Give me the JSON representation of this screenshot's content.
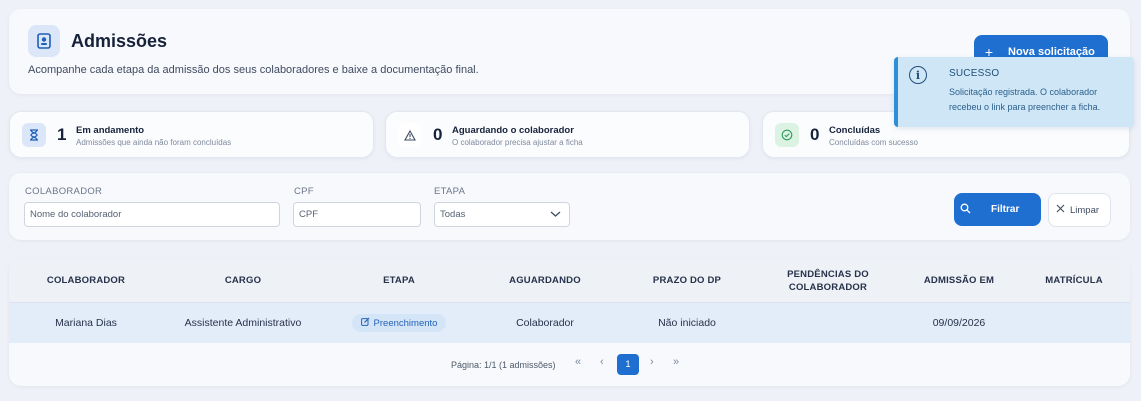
{
  "header": {
    "title": "Admissões",
    "subtitle": "Acompanhe cada etapa da admissão dos seus colaboradores e baixe a documentação final.",
    "new_button_label": "Nova solicitação",
    "icon": "id-badge-icon"
  },
  "toast": {
    "title": "SUCESSO",
    "message": "Solicitação registrada. O colaborador recebeu o link para preencher a ficha.",
    "icon": "info-icon"
  },
  "stats": [
    {
      "count": "1",
      "label": "Em andamento",
      "desc": "Admissões que ainda não foram concluídas",
      "icon": "hourglass-icon",
      "color": "#dbe7f8"
    },
    {
      "count": "0",
      "label": "Aguardando o colaborador",
      "desc": "O colaborador precisa ajustar a ficha",
      "icon": "warning-icon",
      "color": "#ffffff"
    },
    {
      "count": "0",
      "label": "Concluídas",
      "desc": "Concluídas com sucesso",
      "icon": "check-circle-icon",
      "color": "#dcf3e4"
    }
  ],
  "filters": {
    "colaborador_label": "COLABORADOR",
    "colaborador_placeholder": "Nome do colaborador",
    "cpf_label": "CPF",
    "cpf_placeholder": "CPF",
    "etapa_label": "ETAPA",
    "etapa_value": "Todas",
    "filter_button": "Filtrar",
    "clear_button": "Limpar"
  },
  "table": {
    "headers": [
      "COLABORADOR",
      "CARGO",
      "ETAPA",
      "AGUARDANDO",
      "PRAZO DO DP",
      "PENDÊNCIAS DO COLABORADOR",
      "ADMISSÃO EM",
      "MATRÍCULA"
    ],
    "rows": [
      {
        "colaborador": "Mariana Dias",
        "cargo": "Assistente Administrativo",
        "etapa": "Preenchimento",
        "aguardando": "Colaborador",
        "prazo": "Não iniciado",
        "pendencias": "",
        "admissao": "09/09/2026",
        "matricula": ""
      }
    ]
  },
  "pagination": {
    "info": "Página: 1/1 (1 admissões)",
    "first": "«",
    "prev": "‹",
    "current": "1",
    "next": "›",
    "last": "»"
  },
  "colors": {
    "primary": "#1f6fd1",
    "toast_bg": "#cfe6f7",
    "row_highlight": "#e3edf9"
  }
}
